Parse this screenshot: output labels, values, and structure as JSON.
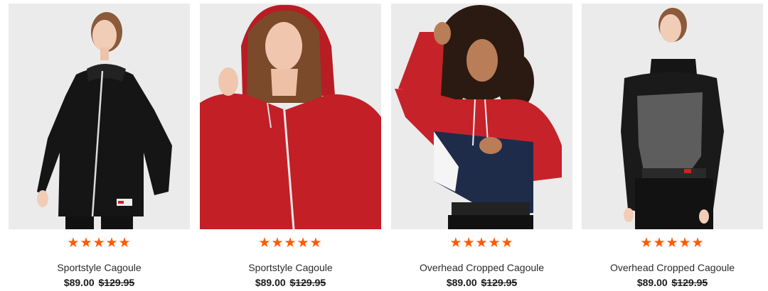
{
  "products": [
    {
      "name": "Sportstyle Cagoule",
      "price": "$89.00",
      "original_price": "$129.95",
      "rating_stars": "★★★★★",
      "rating": 5,
      "image_icon": "black-cagoule-photo"
    },
    {
      "name": "Sportstyle Cagoule",
      "price": "$89.00",
      "original_price": "$129.95",
      "rating_stars": "★★★★★",
      "rating": 5,
      "image_icon": "red-cagoule-photo"
    },
    {
      "name": "Overhead Cropped Cagoule",
      "price": "$89.00",
      "original_price": "$129.95",
      "rating_stars": "★★★★★",
      "rating": 5,
      "image_icon": "red-navy-cropped-cagoule-photo"
    },
    {
      "name": "Overhead Cropped Cagoule",
      "price": "$89.00",
      "original_price": "$129.95",
      "rating_stars": "★★★★★",
      "rating": 5,
      "image_icon": "black-grey-cropped-cagoule-photo"
    }
  ],
  "colors": {
    "star": "#ff5a00",
    "image_bg": "#ebebeb"
  }
}
